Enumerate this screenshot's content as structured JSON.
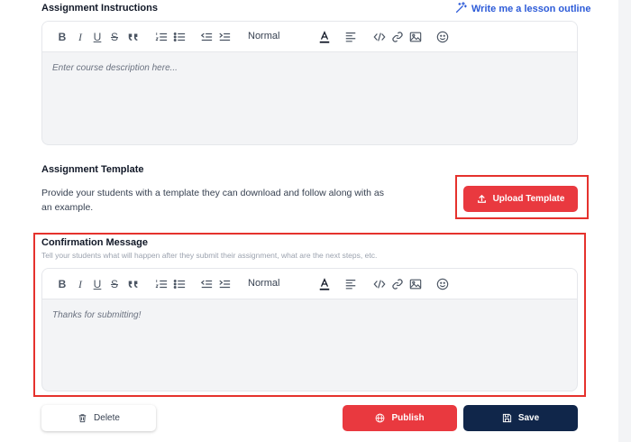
{
  "instructions": {
    "title": "Assignment Instructions",
    "ai_link": "Write me a lesson outline",
    "toolbar": {
      "style_label": "Normal"
    },
    "placeholder": "Enter course description here..."
  },
  "template": {
    "title": "Assignment Template",
    "description": "Provide your students with a template they can download and follow along with as an example.",
    "upload_label": "Upload Template"
  },
  "confirmation": {
    "title": "Confirmation Message",
    "subtitle": "Tell your students what will happen after they submit their assignment, what are the next steps, etc.",
    "toolbar": {
      "style_label": "Normal"
    },
    "body": "Thanks for submitting!"
  },
  "actions": {
    "delete_label": "Delete",
    "publish_label": "Publish",
    "save_label": "Save"
  },
  "icons": {
    "ai_link": "magic-wand-icon",
    "upload": "upload-icon",
    "delete": "trash-icon",
    "publish": "globe-icon",
    "save": "floppy-disk-icon"
  },
  "colors": {
    "primary_red": "#e9393f",
    "navy": "#10264a",
    "link_blue": "#2d5bd8",
    "highlight": "#e5322d"
  }
}
